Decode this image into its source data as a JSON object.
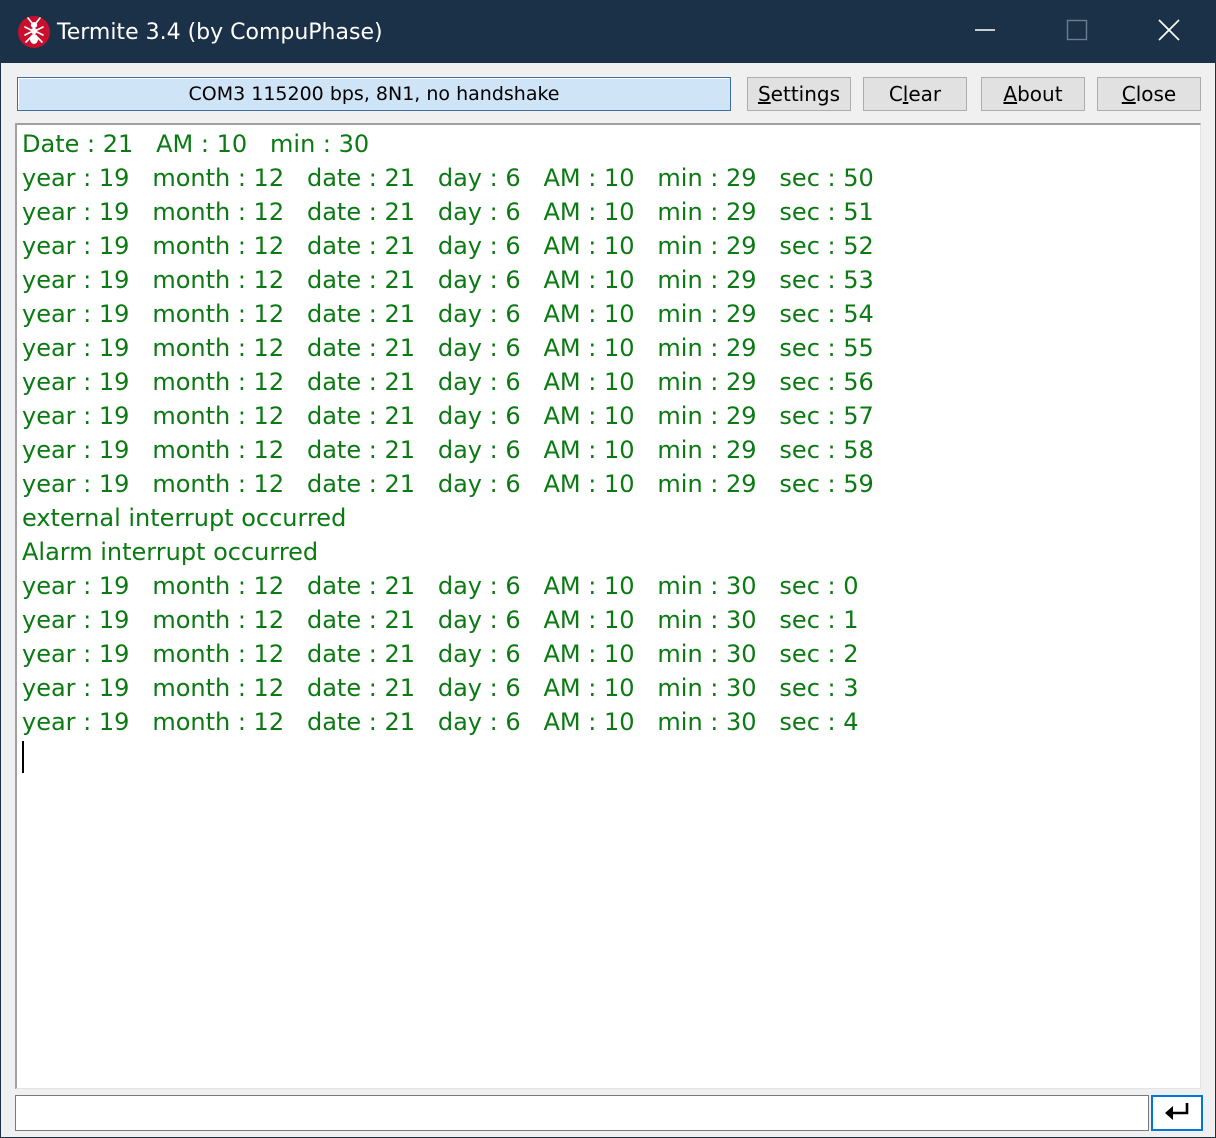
{
  "window": {
    "title": "Termite 3.4 (by CompuPhase)",
    "icons": {
      "app": "ant-icon",
      "minimize": "minimize-icon",
      "maximize": "maximize-icon",
      "close": "close-icon",
      "send": "enter-arrow-icon"
    },
    "colors": {
      "titlebar": "#1b3148",
      "terminal_text": "#0b7a12",
      "status_bg": "#cfe4f7",
      "focus_border": "#0078d7"
    }
  },
  "toolbar": {
    "status": "COM3 115200 bps, 8N1, no handshake",
    "settings_label": {
      "key": "S",
      "rest": "ettings"
    },
    "clear_label": {
      "pre": "C",
      "key": "l",
      "rest": "ear"
    },
    "about_label": {
      "key": "A",
      "rest": "bout"
    },
    "close_label": {
      "key": "C",
      "rest": "lose"
    }
  },
  "terminal": {
    "lines": [
      "Date : 21   AM : 10   min : 30",
      "year : 19   month : 12   date : 21   day : 6   AM : 10   min : 29   sec : 50",
      "year : 19   month : 12   date : 21   day : 6   AM : 10   min : 29   sec : 51",
      "year : 19   month : 12   date : 21   day : 6   AM : 10   min : 29   sec : 52",
      "year : 19   month : 12   date : 21   day : 6   AM : 10   min : 29   sec : 53",
      "year : 19   month : 12   date : 21   day : 6   AM : 10   min : 29   sec : 54",
      "year : 19   month : 12   date : 21   day : 6   AM : 10   min : 29   sec : 55",
      "year : 19   month : 12   date : 21   day : 6   AM : 10   min : 29   sec : 56",
      "year : 19   month : 12   date : 21   day : 6   AM : 10   min : 29   sec : 57",
      "year : 19   month : 12   date : 21   day : 6   AM : 10   min : 29   sec : 58",
      "year : 19   month : 12   date : 21   day : 6   AM : 10   min : 29   sec : 59",
      "external interrupt occurred",
      "Alarm interrupt occurred",
      "year : 19   month : 12   date : 21   day : 6   AM : 10   min : 30   sec : 0",
      "year : 19   month : 12   date : 21   day : 6   AM : 10   min : 30   sec : 1",
      "year : 19   month : 12   date : 21   day : 6   AM : 10   min : 30   sec : 2",
      "year : 19   month : 12   date : 21   day : 6   AM : 10   min : 30   sec : 3",
      "year : 19   month : 12   date : 21   day : 6   AM : 10   min : 30   sec : 4"
    ]
  },
  "input": {
    "value": "",
    "placeholder": ""
  }
}
